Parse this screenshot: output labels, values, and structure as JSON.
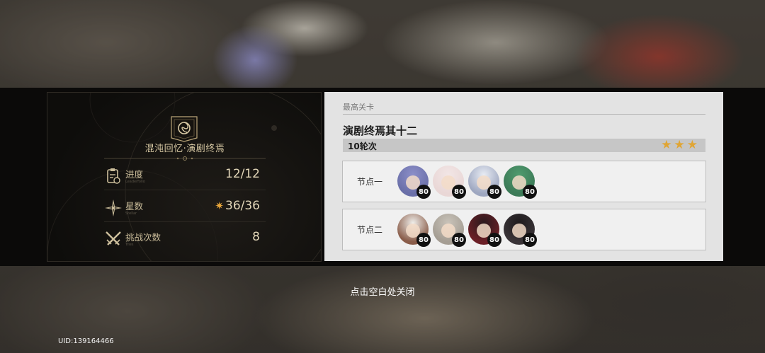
{
  "mode": {
    "title": "混沌回忆·演剧终焉",
    "stats": [
      {
        "label": "进度",
        "sublabel": "Leaderfolio",
        "value": "12/12",
        "icon": "clipboard-icon"
      },
      {
        "label": "星数",
        "sublabel": "Stellar",
        "value": "36/36",
        "icon": "compass-star-icon"
      },
      {
        "label": "挑战次数",
        "sublabel": "Tries",
        "value": "8",
        "icon": "crossed-swords-icon"
      }
    ]
  },
  "record": {
    "header": "最高关卡",
    "stage": "演剧终焉其十二",
    "rounds": "10轮次",
    "stars": "★★★",
    "nodes": [
      {
        "label": "节点一",
        "characters": [
          {
            "level": "80",
            "color": "#6a6fa8",
            "hair": "#8c8fc9"
          },
          {
            "level": "80",
            "color": "#e9d7d6",
            "hair": "#f2e6e6"
          },
          {
            "level": "80",
            "color": "#9ea7c0",
            "hair": "#e8ecf4"
          },
          {
            "level": "80",
            "color": "#3c7a57",
            "hair": "#4f9b6e"
          }
        ]
      },
      {
        "label": "节点二",
        "characters": [
          {
            "level": "80",
            "color": "#8a5d4a",
            "hair": "#efeeea"
          },
          {
            "level": "80",
            "color": "#a49d93",
            "hair": "#c9c3b9"
          },
          {
            "level": "80",
            "color": "#6b1f26",
            "hair": "#2a1a1e"
          },
          {
            "level": "80",
            "color": "#3a3438",
            "hair": "#1f1b1d"
          }
        ]
      }
    ]
  },
  "close_hint": "点击空白处关闭",
  "uid": "UID:139164466",
  "colors": {
    "gold": "#d8c9a4",
    "star": "#e0a534"
  }
}
